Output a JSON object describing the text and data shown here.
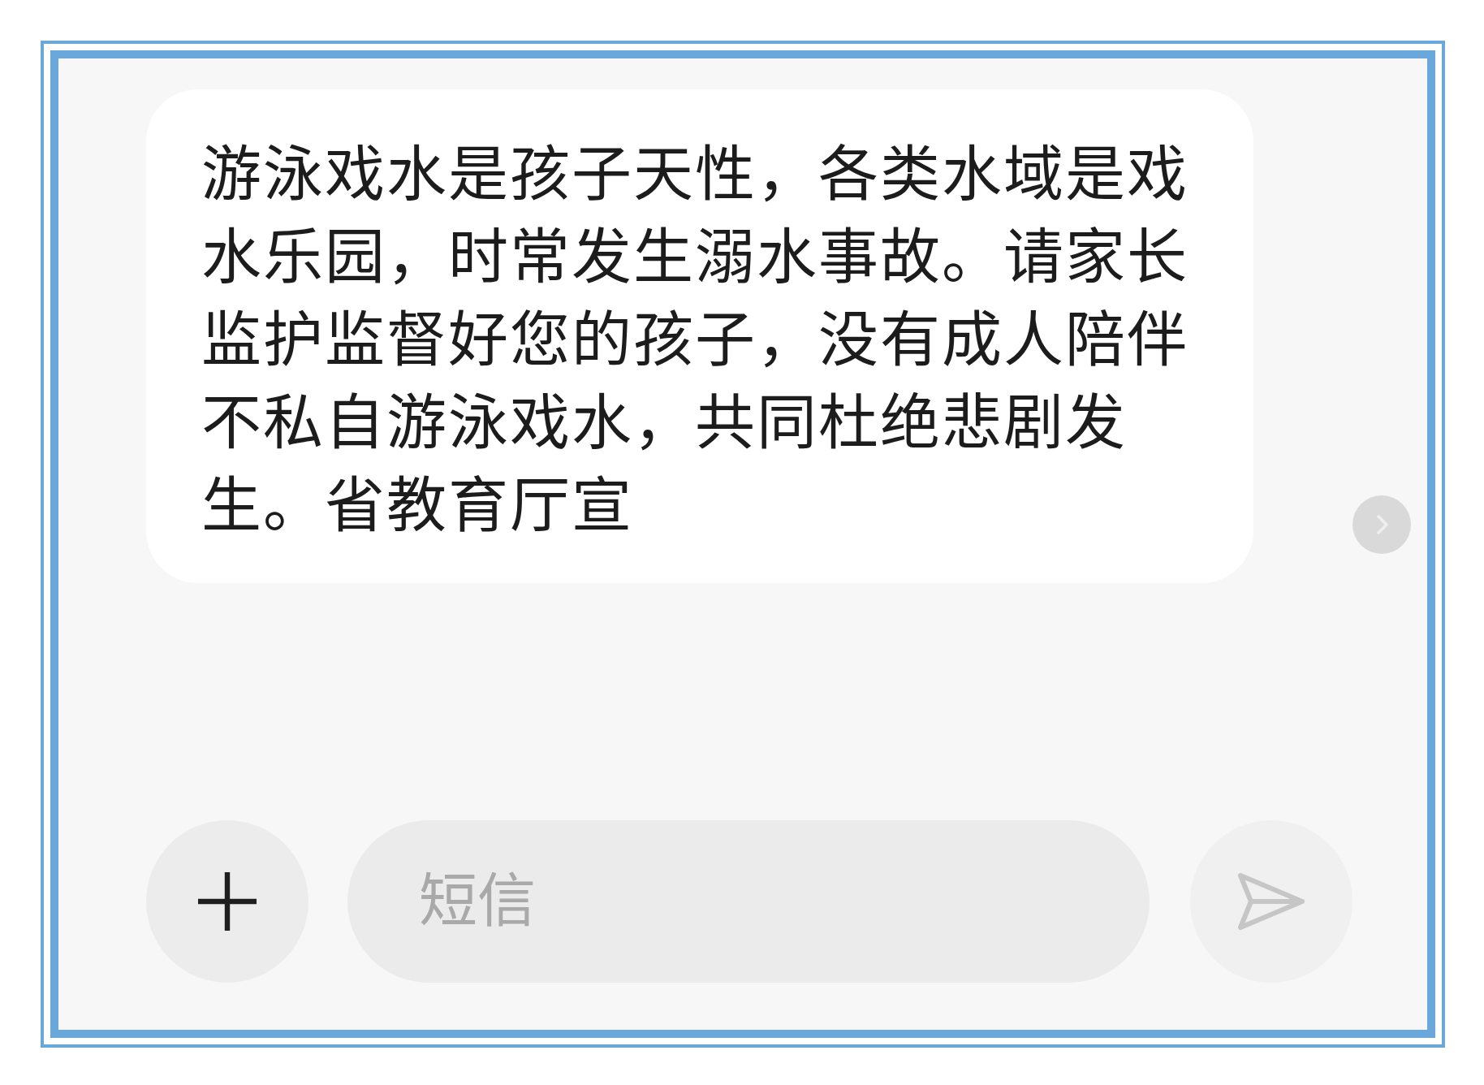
{
  "message": {
    "text": "游泳戏水是孩子天性，各类水域是戏水乐园，时常发生溺水事故。请家长监护监督好您的孩子，没有成人陪伴不私自游泳戏水，共同杜绝悲剧发生。省教育厅宣"
  },
  "composer": {
    "placeholder": "短信"
  },
  "send_button": {
    "disabled": true
  }
}
